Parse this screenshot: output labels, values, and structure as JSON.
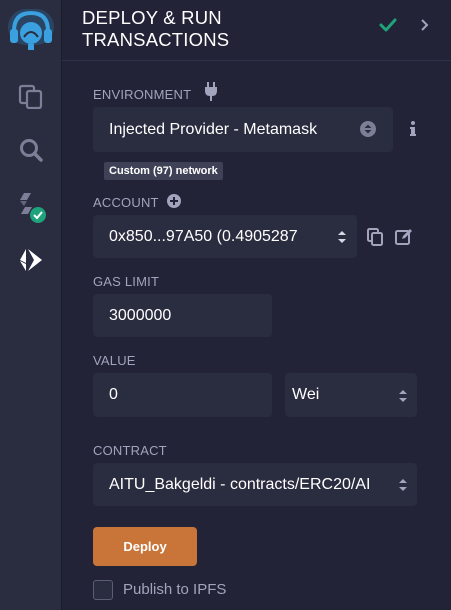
{
  "icon_bar": {
    "items": [
      {
        "icon": "remix-logo-icon"
      },
      {
        "icon": "file-explorer-icon"
      },
      {
        "icon": "search-icon"
      },
      {
        "icon": "solidity-compiler-icon"
      },
      {
        "icon": "deploy-run-icon"
      }
    ]
  },
  "header": {
    "title_line1": "DEPLOY & RUN",
    "title_line2": "TRANSACTIONS",
    "status_icon": "check-icon",
    "expand_icon": "chevron-right-icon"
  },
  "environment": {
    "label": "ENVIRONMENT",
    "label_icon": "plug-icon",
    "value": "Injected Provider - Metamask",
    "info_icon": "info-icon",
    "network_badge": "Custom (97) network"
  },
  "account": {
    "label": "ACCOUNT",
    "add_icon": "plus-circle-icon",
    "value": "0x850...97A50 (0.4905287",
    "copy_icon": "copy-icon",
    "edit_icon": "edit-icon"
  },
  "gas_limit": {
    "label": "GAS LIMIT",
    "value": "3000000"
  },
  "value": {
    "label": "VALUE",
    "amount": "0",
    "unit": "Wei"
  },
  "contract": {
    "label": "CONTRACT",
    "value": "AITU_Bakgeldi - contracts/ERC20/AI"
  },
  "deploy_button": "Deploy",
  "publish_ipfs": {
    "label": "Publish to IPFS",
    "checked": false
  },
  "colors": {
    "background": "#222336",
    "field": "#2a2c3f",
    "accent": "#c97539",
    "success": "#1ea37a"
  }
}
